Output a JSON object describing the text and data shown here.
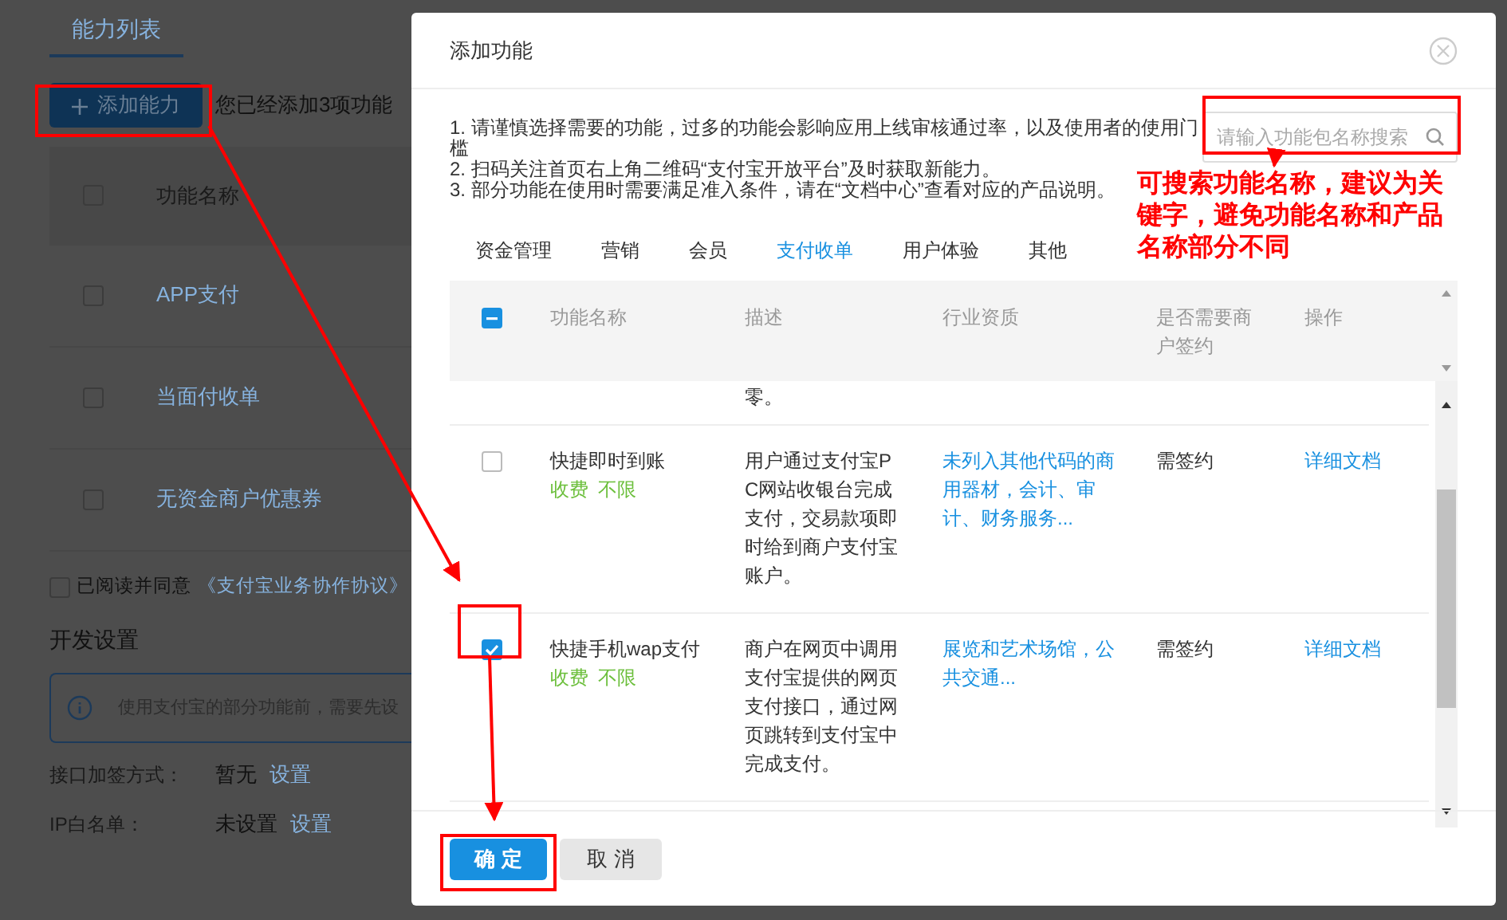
{
  "background_page": {
    "tab": "能力列表",
    "add_button": "添加能力",
    "added_count": "您已经添加3项功能",
    "table": {
      "column": "功能名称",
      "header_checked": false,
      "rows": [
        {
          "name": "APP支付",
          "checked": false
        },
        {
          "name": "当面付收单",
          "checked": false
        },
        {
          "name": "无资金商户优惠券",
          "checked": false
        }
      ]
    },
    "agreement": {
      "label": "已阅读并同意",
      "link": "《支付宝业务协作协议》",
      "checked": false
    },
    "section_title": "开发设置",
    "alert": "使用支付宝的部分功能前，需要先设",
    "settings": [
      {
        "label": "接口加签方式：",
        "value": "暂无",
        "action": "设置"
      },
      {
        "label": "IP白名单：",
        "value": "未设置",
        "action": "设置"
      }
    ]
  },
  "dialog": {
    "title": "添加功能",
    "notes": [
      "1. 请谨慎选择需要的功能，过多的功能会影响应用上线审核通过率，以及使用者的使用门槛",
      "2. 扫码关注首页右上角二维码“支付宝开放平台”及时获取新能力。",
      "3. 部分功能在使用时需要满足准入条件，请在“文档中心”查看对应的产品说明。"
    ],
    "search": {
      "placeholder": "请输入功能包名称搜索"
    },
    "tabs": [
      {
        "label": "资金管理",
        "selected": false
      },
      {
        "label": "营销",
        "selected": false
      },
      {
        "label": "会员",
        "selected": false
      },
      {
        "label": "支付收单",
        "selected": true
      },
      {
        "label": "用户体验",
        "selected": false
      },
      {
        "label": "其他",
        "selected": false
      }
    ],
    "table": {
      "select_all": {
        "indeterminate": true
      },
      "columns": [
        "功能名称",
        "描述",
        "行业资质",
        "是否需要商户签约",
        "操作"
      ],
      "rows": [
        {
          "kind": "fragment",
          "description": "零。"
        },
        {
          "kind": "item",
          "checked": false,
          "name": "快捷即时到账",
          "tags": [
            "收费",
            "不限"
          ],
          "description": "用户通过支付宝PC网站收银台完成支付，交易款项即时给到商户支付宝账户。",
          "qualification": "未列入其他代码的商用器材，会计、审计、财务服务...",
          "signing": "需签约",
          "action": "详细文档"
        },
        {
          "kind": "item",
          "checked": true,
          "name": "快捷手机wap支付",
          "tags": [
            "收费",
            "不限"
          ],
          "description": "商户在网页中调用支付宝提供的网页支付接口，通过网页跳转到支付宝中完成支付。",
          "qualification": "展览和艺术场馆，公共交通...",
          "signing": "需签约",
          "action": "详细文档"
        }
      ]
    },
    "buttons": [
      {
        "kind": "primary",
        "label": "确 定"
      },
      {
        "kind": "secondary",
        "label": "取 消"
      }
    ]
  },
  "annotation": "可搜索功能名称，建议为关键字，避免功能名称和产品名称部分不同"
}
